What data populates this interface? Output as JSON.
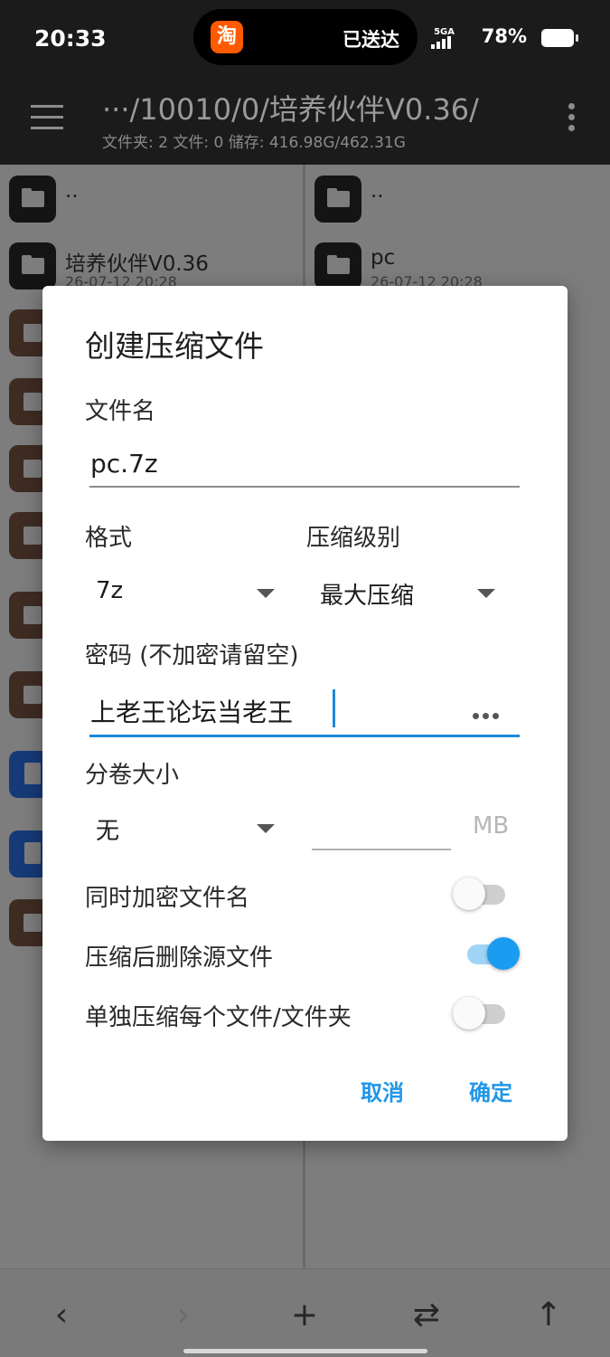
{
  "status_bar": {
    "time": "20:33",
    "island_app_glyph": "淘",
    "island_text": "已送达",
    "network": "5GA",
    "battery_percent": "78%",
    "battery_level": 0.78
  },
  "app_bar": {
    "path": "···/10010/0/培养伙伴V0.36/",
    "subtitle": "文件夹: 2  文件: 0  储存: 416.98G/462.31G"
  },
  "left_pane": {
    "items": [
      {
        "name": "..",
        "date": "",
        "type": "folder"
      },
      {
        "name": "培养伙伴V0.36",
        "date": "26-07-12 20:28",
        "type": "folder"
      },
      {
        "name": "",
        "date": "",
        "type": "archive"
      },
      {
        "name": "",
        "date": "",
        "type": "archive"
      },
      {
        "name": "",
        "date": "",
        "type": "archive"
      },
      {
        "name": "",
        "date": "",
        "type": "archive"
      },
      {
        "name": "",
        "date": "",
        "type": "archive"
      },
      {
        "name": "",
        "date": "",
        "type": "archive"
      },
      {
        "name": "",
        "date": "",
        "type": "doc"
      },
      {
        "name": "",
        "date": "",
        "type": "doc"
      },
      {
        "name": "",
        "date": "",
        "type": "archive"
      }
    ]
  },
  "right_pane": {
    "items": [
      {
        "name": "..",
        "date": "",
        "type": "folder"
      },
      {
        "name": "pc",
        "date": "26-07-12 20:28",
        "type": "folder"
      }
    ]
  },
  "dialog": {
    "title": "创建压缩文件",
    "filename_label": "文件名",
    "filename_value": "pc.7z",
    "format_label": "格式",
    "format_value": "7z",
    "level_label": "压缩级别",
    "level_value": "最大压缩",
    "password_label": "密码 (不加密请留空)",
    "password_value": "上老王论坛当老王",
    "volume_label": "分卷大小",
    "volume_value": "无",
    "volume_size_value": "",
    "volume_unit": "MB",
    "encrypt_names_label": "同时加密文件名",
    "encrypt_names_on": false,
    "delete_source_label": "压缩后删除源文件",
    "delete_source_on": true,
    "separate_label": "单独压缩每个文件/文件夹",
    "separate_on": false,
    "cancel_label": "取消",
    "ok_label": "确定"
  },
  "bottom_bar": {
    "back_icon": "‹",
    "forward_icon": "›",
    "add_icon": "+",
    "swap_icon": "⇄",
    "up_icon": "↑"
  },
  "colors": {
    "accent": "#2196e8",
    "switch_on": "#1a9cf0",
    "bar_bg": "#1b1b1b"
  }
}
